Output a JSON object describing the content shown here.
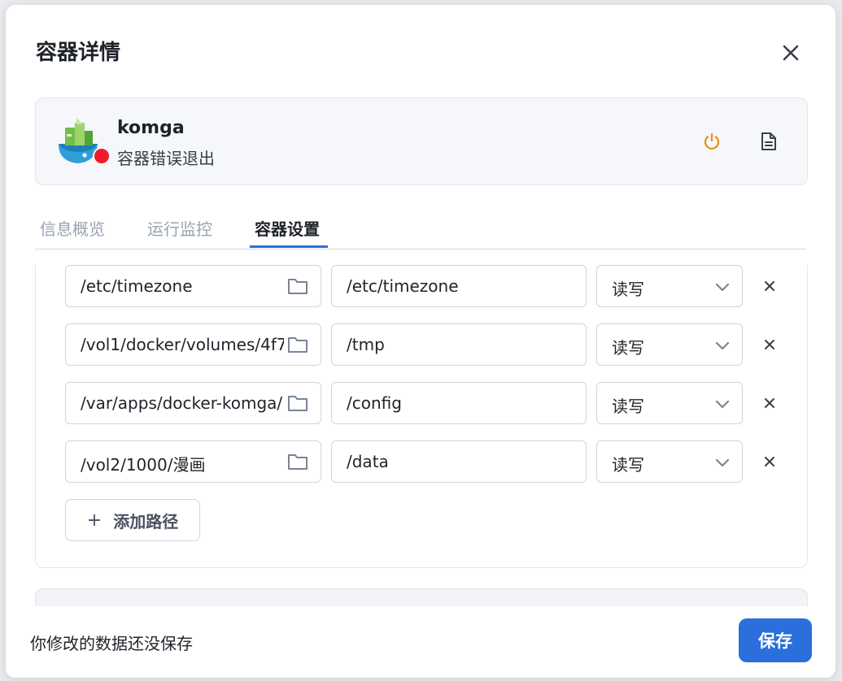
{
  "dialog": {
    "title": "容器详情"
  },
  "container": {
    "name": "komga",
    "status": "容器错误退出",
    "status_color": "#ef1c2c"
  },
  "tabs": [
    {
      "label": "信息概览",
      "active": false
    },
    {
      "label": "运行监控",
      "active": false
    },
    {
      "label": "容器设置",
      "active": true
    }
  ],
  "volumes": [
    {
      "host_path": "/etc/timezone",
      "container_path": "/etc/timezone",
      "mode": "读写"
    },
    {
      "host_path": "/vol1/docker/volumes/4f7",
      "container_path": "/tmp",
      "mode": "读写"
    },
    {
      "host_path": "/var/apps/docker-komga/",
      "container_path": "/config",
      "mode": "读写"
    },
    {
      "host_path": "/vol2/1000/漫画",
      "container_path": "/data",
      "mode": "读写"
    }
  ],
  "add_path_label": "添加路径",
  "footer": {
    "unsaved_note": "你修改的数据还没保存",
    "save_label": "保存"
  },
  "colors": {
    "accent": "#2a6fdb",
    "power_icon": "#e8900c"
  }
}
